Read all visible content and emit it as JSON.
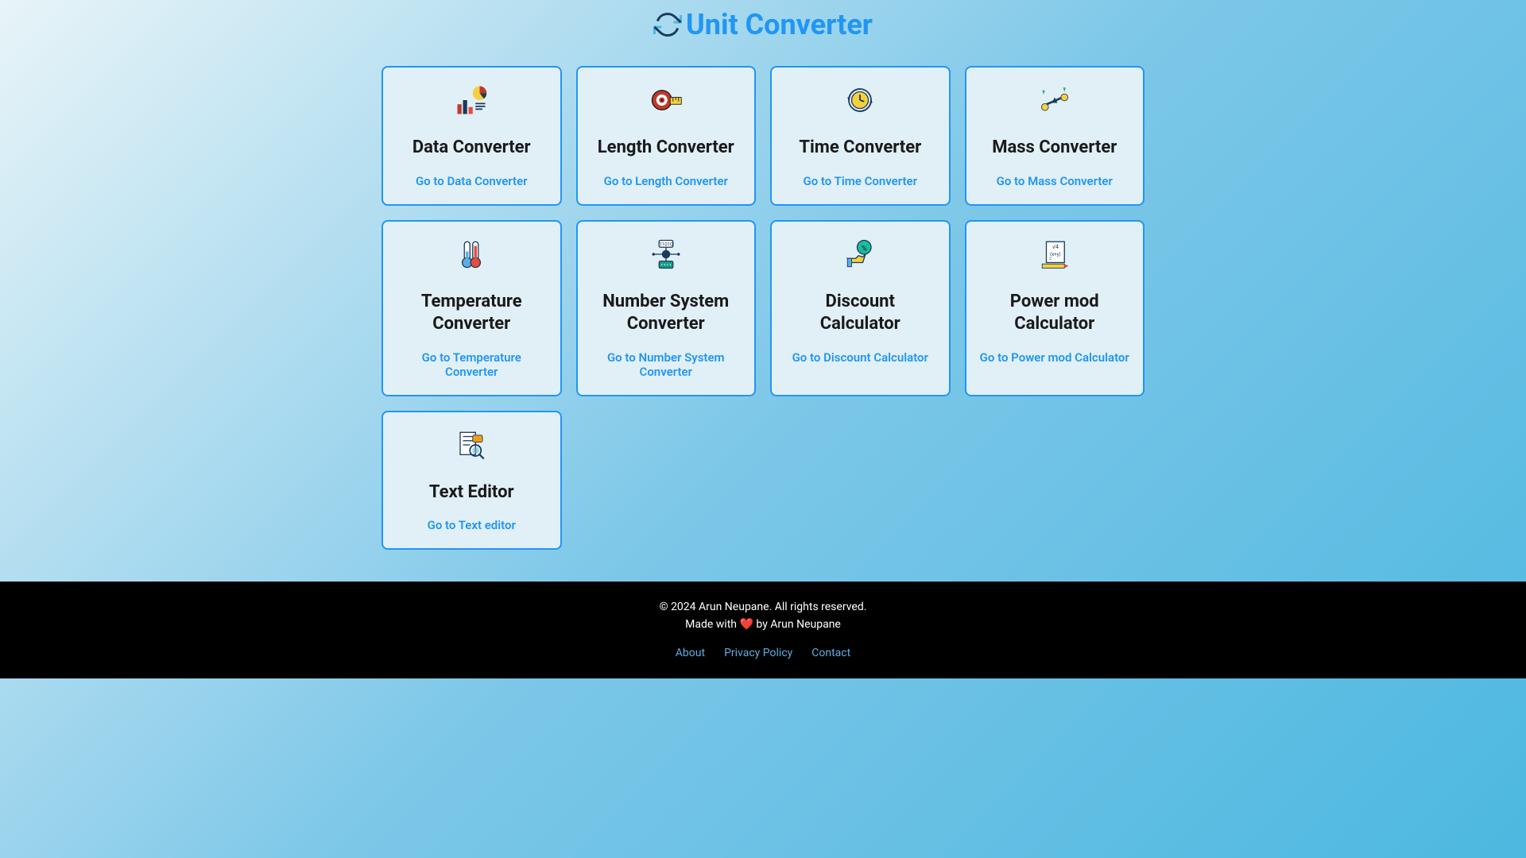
{
  "header": {
    "title": "Unit Converter"
  },
  "cards": [
    {
      "title": "Data Converter",
      "link": "Go to Data Converter",
      "icon": "data-icon"
    },
    {
      "title": "Length Converter",
      "link": "Go to Length Converter",
      "icon": "length-icon"
    },
    {
      "title": "Time Converter",
      "link": "Go to Time Converter",
      "icon": "time-icon"
    },
    {
      "title": "Mass Converter",
      "link": "Go to Mass Converter",
      "icon": "mass-icon"
    },
    {
      "title": "Temperature Converter",
      "link": "Go to Temperature Converter",
      "icon": "temperature-icon"
    },
    {
      "title": "Number System Converter",
      "link": "Go to Number System Converter",
      "icon": "number-system-icon"
    },
    {
      "title": "Discount Calculator",
      "link": "Go to Discount Calculator",
      "icon": "discount-icon"
    },
    {
      "title": "Power mod Calculator",
      "link": "Go to Power mod Calculator",
      "icon": "power-mod-icon"
    },
    {
      "title": "Text Editor",
      "link": "Go to Text editor",
      "icon": "text-editor-icon"
    }
  ],
  "footer": {
    "copyright": "© 2024 Arun Neupane. All rights reserved.",
    "made": "Made with",
    "heart": "❤️",
    "by": "by Arun Neupane",
    "links": {
      "about": "About",
      "privacy": "Privacy Policy",
      "contact": "Contact"
    }
  }
}
